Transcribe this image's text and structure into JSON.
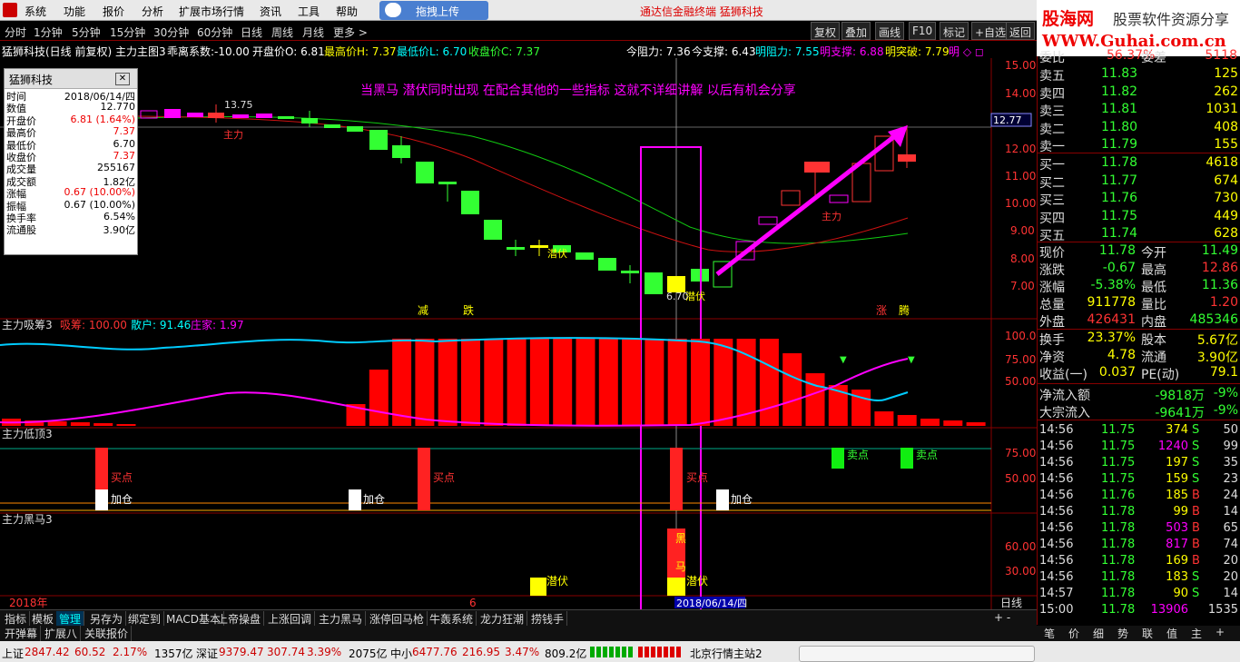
{
  "menu": [
    "系统",
    "功能",
    "报价",
    "分析",
    "扩展市场行情",
    "资讯",
    "工具",
    "帮助"
  ],
  "upload_label": "拖拽上传",
  "app_title": "通达信金融终端   猛狮科技",
  "logo": {
    "line1a": "股海网",
    "line1b": "股票软件资源分享",
    "line2": "WWW.Guhai.com.cn"
  },
  "periods": [
    "分时",
    "1分钟",
    "5分钟",
    "15分钟",
    "30分钟",
    "60分钟",
    "日线",
    "周线",
    "月线",
    "更多 >"
  ],
  "active_period": "日线",
  "right_buttons": [
    "复权",
    "叠加",
    "画线",
    "F10",
    "标记",
    "+自选",
    "返回"
  ],
  "info": {
    "name": "猛狮科技(日线 前复权) 主力主图3",
    "dev": "乖离系数:-10.00",
    "open": "开盘价O: 6.81",
    "high": "最高价H: 7.37",
    "low": "最低价L: 6.70",
    "close": "收盘价C: 7.37",
    "resist": "今阻力: 7.36",
    "support": "今支撑: 6.43",
    "m_resist": "明阻力: 7.55",
    "m_support": "明支撑: 6.88",
    "m_break": "明突破: 7.79",
    "m_more": "明 ◇ ◻"
  },
  "popup": {
    "title": "猛狮科技",
    "close": "✕",
    "rows": [
      {
        "k": "时间",
        "v": "2018/06/14/四",
        "c": "blk"
      },
      {
        "k": "数值",
        "v": "12.770",
        "c": "blk"
      },
      {
        "k": "开盘价",
        "v": "6.81 (1.64%)",
        "c": "red"
      },
      {
        "k": "最高价",
        "v": "7.37",
        "c": "red"
      },
      {
        "k": "最低价",
        "v": "6.70",
        "c": "blk"
      },
      {
        "k": "收盘价",
        "v": "7.37",
        "c": "red"
      },
      {
        "k": "成交量",
        "v": "255167",
        "c": "blk"
      },
      {
        "k": "成交额",
        "v": "1.82亿",
        "c": "blk"
      },
      {
        "k": "涨幅",
        "v": "0.67 (10.00%)",
        "c": "red"
      },
      {
        "k": "振幅",
        "v": "0.67 (10.00%)",
        "c": "blk"
      },
      {
        "k": "换手率",
        "v": "6.54%",
        "c": "blk"
      },
      {
        "k": "流通股",
        "v": "3.90亿",
        "c": "blk"
      }
    ]
  },
  "annotation": "当黑马  潜伏同时出现   在配合其他的一些指标  这就不详细讲解  以后有机会分享",
  "chart_text": {
    "hi_mark": "13.75",
    "zhuli": "主力",
    "qianfu": "潜伏",
    "low_mark": "6.70",
    "jian": "减",
    "die": "跌",
    "zhang": "涨",
    "teng": "腾",
    "cur_price": "12.77",
    "buy": "买点",
    "sell": "卖点",
    "add": "加仓",
    "hei": "黑",
    "ma": "马",
    "year": "2018年",
    "month": "6",
    "date": "2018/06/14/四",
    "period_label": "日线"
  },
  "price_axis": [
    "15.00",
    "14.00",
    "13.00",
    "12.00",
    "11.00",
    "10.00",
    "9.00",
    "8.00",
    "7.00"
  ],
  "panel2": {
    "title": "主力吸筹3",
    "a": "吸筹: 100.00",
    "b": "散户: 91.46",
    "c": "庄家: 1.97",
    "axis": [
      "100.0",
      "75.00",
      "50.00"
    ]
  },
  "panel3": {
    "title": "主力低顶3",
    "axis": [
      "75.00",
      "50.00"
    ]
  },
  "panel4": {
    "title": "主力黑马3",
    "axis": [
      "60.00",
      "30.00"
    ]
  },
  "quote": {
    "top_label": "委比",
    "top_val": "56.37%",
    "top_label2": "委差",
    "top_val2": "5118",
    "asks": [
      {
        "l": "卖五",
        "p": "11.83",
        "v": "125"
      },
      {
        "l": "卖四",
        "p": "11.82",
        "v": "262"
      },
      {
        "l": "卖三",
        "p": "11.81",
        "v": "1031"
      },
      {
        "l": "卖二",
        "p": "11.80",
        "v": "408"
      },
      {
        "l": "卖一",
        "p": "11.79",
        "v": "155"
      }
    ],
    "bids": [
      {
        "l": "买一",
        "p": "11.78",
        "v": "4618"
      },
      {
        "l": "买二",
        "p": "11.77",
        "v": "674"
      },
      {
        "l": "买三",
        "p": "11.76",
        "v": "730"
      },
      {
        "l": "买四",
        "p": "11.75",
        "v": "449"
      },
      {
        "l": "买五",
        "p": "11.74",
        "v": "628"
      }
    ],
    "stats": [
      {
        "a": "现价",
        "av": "11.78",
        "ac": "grn",
        "b": "今开",
        "bv": "11.49",
        "bc": "grn"
      },
      {
        "a": "涨跌",
        "av": "-0.67",
        "ac": "grn",
        "b": "最高",
        "bv": "12.86",
        "bc": "red"
      },
      {
        "a": "涨幅",
        "av": "-5.38%",
        "ac": "grn",
        "b": "最低",
        "bv": "11.36",
        "bc": "grn"
      },
      {
        "a": "总量",
        "av": "911778",
        "ac": "yel",
        "b": "量比",
        "bv": "1.20",
        "bc": "red"
      },
      {
        "a": "外盘",
        "av": "426431",
        "ac": "red",
        "b": "内盘",
        "bv": "485346",
        "bc": "grn"
      }
    ],
    "stats2": [
      {
        "a": "换手",
        "av": "23.37%",
        "b": "股本",
        "bv": "5.67亿"
      },
      {
        "a": "净资",
        "av": "4.78",
        "b": "流通",
        "bv": "3.90亿"
      },
      {
        "a": "收益(一)",
        "av": "0.037",
        "b": "PE(动)",
        "bv": "79.1"
      }
    ],
    "flow": [
      {
        "a": "净流入额",
        "v": "-9818万",
        "p": "-9%"
      },
      {
        "a": "大宗流入",
        "v": "-9641万",
        "p": "-9%"
      }
    ],
    "ticks": [
      {
        "t": "14:56",
        "p": "11.75",
        "v": "374",
        "vc": "yel",
        "d": "S",
        "n": "50"
      },
      {
        "t": "14:56",
        "p": "11.75",
        "v": "1240",
        "vc": "mag",
        "d": "S",
        "n": "99"
      },
      {
        "t": "14:56",
        "p": "11.75",
        "v": "197",
        "vc": "yel",
        "d": "S",
        "n": "35"
      },
      {
        "t": "14:56",
        "p": "11.75",
        "v": "159",
        "vc": "yel",
        "d": "S",
        "n": "23"
      },
      {
        "t": "14:56",
        "p": "11.76",
        "v": "185",
        "vc": "yel",
        "d": "B",
        "n": "24"
      },
      {
        "t": "14:56",
        "p": "11.78",
        "v": "99",
        "vc": "yel",
        "d": "B",
        "n": "14"
      },
      {
        "t": "14:56",
        "p": "11.78",
        "v": "503",
        "vc": "mag",
        "d": "B",
        "n": "65"
      },
      {
        "t": "14:56",
        "p": "11.78",
        "v": "817",
        "vc": "mag",
        "d": "B",
        "n": "74"
      },
      {
        "t": "14:56",
        "p": "11.78",
        "v": "169",
        "vc": "yel",
        "d": "B",
        "n": "20"
      },
      {
        "t": "14:56",
        "p": "11.78",
        "v": "183",
        "vc": "yel",
        "d": "S",
        "n": "20"
      },
      {
        "t": "14:57",
        "p": "11.78",
        "v": "90",
        "vc": "yel",
        "d": "S",
        "n": "14"
      },
      {
        "t": "15:00",
        "p": "11.78",
        "v": "13906",
        "vc": "mag",
        "d": "",
        "n": "1535"
      }
    ]
  },
  "tabs1": [
    "指标",
    "模板",
    "管理",
    "另存为",
    "绑定到",
    "MACD基本",
    "上帝操盘",
    "上涨回调",
    "主力黑马",
    "涨停回马枪",
    "牛轰系统",
    "龙力狂潮",
    "捞钱手"
  ],
  "tabs2": [
    "开弹幕",
    "扩展八",
    "关联报价"
  ],
  "qtabs": [
    "笔",
    "价",
    "细",
    "势",
    "联",
    "值",
    "主",
    "+"
  ],
  "status": {
    "sh": "上证",
    "sh_v": "2847.42",
    "sh_c": "60.52",
    "sh_p": "2.17%",
    "sh_a": "1357亿",
    "sz": "深证",
    "sz_v": "9379.47",
    "sz_c": "307.74",
    "sz_p": "3.39%",
    "sz_a": "2075亿",
    "zx": "中小",
    "zx_v": "6477.76",
    "zx_c": "216.95",
    "zx_p": "3.47%",
    "zx_a": "809.2亿",
    "server": "北京行情主站2"
  },
  "colors": {
    "up": "#ff2020",
    "down": "#20ff20",
    "frame": "#ff00ff",
    "accent": "#0000aa"
  }
}
